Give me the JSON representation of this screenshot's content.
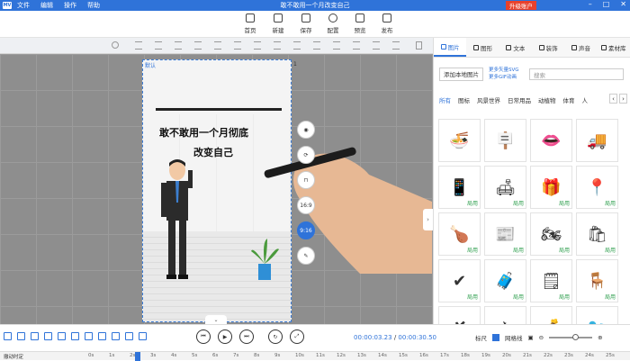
{
  "app": {
    "logo": "MV",
    "title": "敢不敢用一个月改变自己",
    "upgrade": "升级账户",
    "menu": [
      "文件",
      "编辑",
      "操作",
      "帮助"
    ]
  },
  "toolbar": {
    "items": [
      {
        "label": "首页",
        "icon": "home-icon"
      },
      {
        "label": "新建",
        "icon": "new-file-icon"
      },
      {
        "label": "保存",
        "icon": "save-icon"
      },
      {
        "label": "配置",
        "icon": "settings-icon"
      },
      {
        "label": "预览",
        "icon": "preview-icon"
      },
      {
        "label": "发布",
        "icon": "publish-icon"
      }
    ]
  },
  "stage": {
    "label": "默认",
    "scene_number": "1",
    "headline_1": "敢不敢用一个月彻底",
    "headline_2": "改变自己"
  },
  "side_buttons": [
    "camera-icon",
    "replace-icon",
    "lock-icon",
    "16:9",
    "9:16",
    "edit-icon"
  ],
  "side_button_labels": {
    "ratio_169": "16:9",
    "ratio_916": "9:16"
  },
  "panel": {
    "tabs": [
      "图片",
      "图形",
      "文本",
      "装饰",
      "声音",
      "素材库"
    ],
    "add_local": "添加本地图片",
    "link_svg": "更多矢量SVG",
    "link_gif": "更多GIF动画",
    "search_placeholder": "搜索",
    "categories": [
      "所有",
      "图标",
      "风景世界",
      "日常用品",
      "动植物",
      "体育",
      "人"
    ],
    "used_label": "局用",
    "items": [
      {
        "name": "noodle-bowl-icon"
      },
      {
        "name": "signboard-icon"
      },
      {
        "name": "lips-icon"
      },
      {
        "name": "truck-icon"
      },
      {
        "name": "smartphone-icon",
        "used": true
      },
      {
        "name": "sofa-icon",
        "used": true
      },
      {
        "name": "gift-box-icon",
        "used": true
      },
      {
        "name": "map-pin-icon",
        "used": true
      },
      {
        "name": "roast-chicken-icon",
        "used": true
      },
      {
        "name": "newspaper-icon",
        "used": true
      },
      {
        "name": "motorcycle-icon",
        "used": true
      },
      {
        "name": "shopping-bag-icon",
        "used": true
      },
      {
        "name": "checkmark-icon",
        "used": true
      },
      {
        "name": "suitcase-icon",
        "used": true
      },
      {
        "name": "notepad-icon",
        "used": true
      },
      {
        "name": "egg-chair-icon",
        "used": true
      },
      {
        "name": "x-mark-icon"
      },
      {
        "name": "airplane-icon"
      },
      {
        "name": "money-bag-icon"
      },
      {
        "name": "bird-icon"
      }
    ]
  },
  "timeline": {
    "current_time": "00:00:03.23",
    "separator": "/",
    "total_time": "00:00:30.50",
    "ruler_label": "标尺",
    "grid_label": "网格线",
    "track_label": "撤动时定",
    "scale_ticks": [
      "0s",
      "1s",
      "2s",
      "3s",
      "4s",
      "5s",
      "6s",
      "7s",
      "8s",
      "9s",
      "10s",
      "11s",
      "12s",
      "13s",
      "14s",
      "15s",
      "16s",
      "17s",
      "18s",
      "19s",
      "20s",
      "21s",
      "22s",
      "23s",
      "24s",
      "25s"
    ]
  },
  "colors": {
    "accent": "#2f73d9",
    "upgrade": "#e8412c",
    "used_tag": "#2f9f4f"
  }
}
